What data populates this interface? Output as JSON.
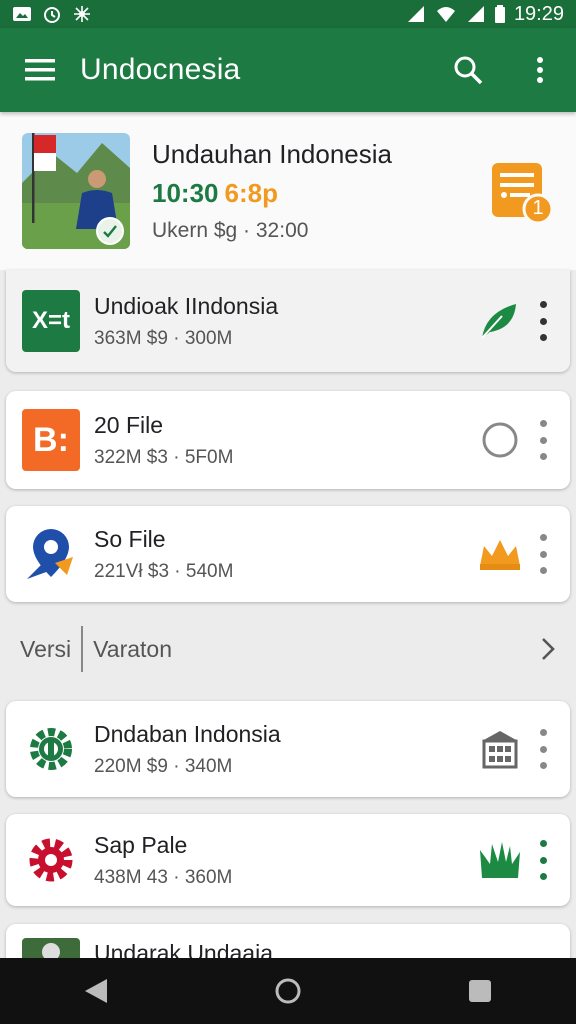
{
  "status_bar": {
    "time": "19:29",
    "icons": [
      "image-icon",
      "alarm-icon",
      "sync-icon",
      "signal-icon",
      "wifi-icon",
      "signal-icon",
      "battery-icon"
    ]
  },
  "app_bar": {
    "title": "Undocnesia",
    "icons": [
      "menu-icon",
      "search-icon",
      "more-vert-icon"
    ]
  },
  "hero": {
    "title": "Undauhan Indonesia",
    "time_primary": "10:30",
    "time_secondary": "6:8p",
    "subtitle": "Ukern  $g · 32:00",
    "badge_count": "1",
    "colors": {
      "green": "#1d7a43",
      "orange": "#f29a1f"
    }
  },
  "items": [
    {
      "name": "Undioak IIndonsia",
      "meta": "363M  $9 · 300M",
      "icon": "spreadsheet-icon",
      "status_icon": "leaf-icon",
      "icon_text": "X=t"
    },
    {
      "name": "20 File",
      "meta": "322M  $3 · 5F0M",
      "icon": "b-app-icon",
      "status_icon": "circle-icon",
      "icon_text": "B:"
    },
    {
      "name": "So File",
      "meta": "221Vł  $3 · 540M",
      "icon": "location-pin-icon",
      "status_icon": "crown-icon"
    },
    {
      "name": "Dndaban Indonsia",
      "meta": "220M  $9 · 340M",
      "icon": "gear-icon",
      "status_icon": "building-icon"
    },
    {
      "name": "Sap Pale",
      "meta": "438M  43 · 360M",
      "icon": "red-gear-icon",
      "status_icon": "grass-icon"
    },
    {
      "name": "Undarak Undaaia",
      "meta": "",
      "icon": "photo-icon",
      "status_icon": "dot-icon"
    }
  ],
  "section": {
    "left": "Versi",
    "right": "Varaton"
  },
  "nav_bar": {
    "icons": [
      "back-icon",
      "home-icon",
      "recents-icon"
    ]
  }
}
